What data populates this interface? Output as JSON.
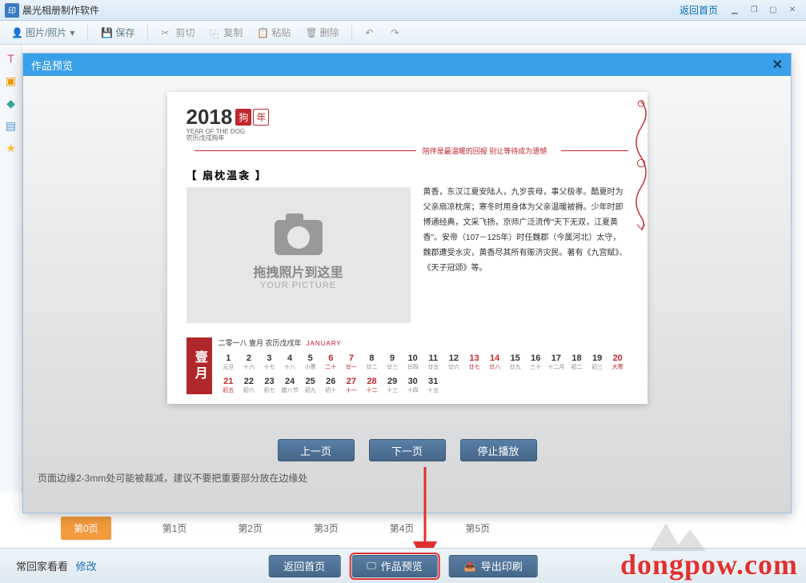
{
  "app": {
    "title": "晨光相册制作软件",
    "home_link": "返回首页"
  },
  "toolbar": {
    "photos": "图片/照片",
    "save": "保存",
    "cut": "剪切",
    "copy": "复制",
    "paste": "粘贴",
    "delete": "删除",
    "undo": "撤销",
    "redo": "重做"
  },
  "modal": {
    "title": "作品预览",
    "prev": "上一页",
    "next": "下一页",
    "stop": "停止播放",
    "hint": "页面边缘2-3mm处可能被裁减，建议不要把重要部分放在边缘处"
  },
  "card": {
    "year": "2018",
    "zodiac_in": "狗",
    "zodiac_out": "年",
    "year_sub_en": "YEAR OF THE DOG",
    "year_sub_cn": "农历戊戌狗年",
    "slogan": "陪伴是最温暖的回报  别让等待成为遗憾",
    "photo_title": "【 扇枕温衾 】",
    "photo_l1": "拖拽照片到这里",
    "photo_l2": "YOUR PICTURE",
    "story": "黄香，东汉江夏安陆人，九岁丧母，事父极孝。酷夏时为父亲扇凉枕席；寒冬时用身体为父亲温暖被褥。少年时即博通经典，文采飞扬，京师广泛流传\"天下无双，江夏黄香\"。安帝（107－125年）时任魏郡（今属河北）太守，魏郡遭受水灾，黄香尽其所有赈济灾民。著有《九宫赋》、《天子冠颂》等。"
  },
  "calendar": {
    "header_cn": "二零一八 壹月 农历戊戌年",
    "header_en": "JANUARY",
    "month_label": "壹月",
    "row1": [
      {
        "n": "1",
        "s": "元旦",
        "w": false
      },
      {
        "n": "2",
        "s": "十六",
        "w": false
      },
      {
        "n": "3",
        "s": "十七",
        "w": false
      },
      {
        "n": "4",
        "s": "十八",
        "w": false
      },
      {
        "n": "5",
        "s": "小寒",
        "w": false
      },
      {
        "n": "6",
        "s": "二十",
        "w": true
      },
      {
        "n": "7",
        "s": "廿一",
        "w": true
      },
      {
        "n": "8",
        "s": "廿二",
        "w": false
      },
      {
        "n": "9",
        "s": "廿三",
        "w": false
      },
      {
        "n": "10",
        "s": "廿四",
        "w": false
      },
      {
        "n": "11",
        "s": "廿五",
        "w": false
      },
      {
        "n": "12",
        "s": "廿六",
        "w": false
      },
      {
        "n": "13",
        "s": "廿七",
        "w": true
      },
      {
        "n": "14",
        "s": "廿八",
        "w": true
      },
      {
        "n": "15",
        "s": "廿九",
        "w": false
      },
      {
        "n": "16",
        "s": "三十",
        "w": false
      },
      {
        "n": "17",
        "s": "十二月",
        "w": false
      },
      {
        "n": "18",
        "s": "初二",
        "w": false
      },
      {
        "n": "19",
        "s": "初三",
        "w": false
      },
      {
        "n": "20",
        "s": "大寒",
        "w": true
      }
    ],
    "row2": [
      {
        "n": "21",
        "s": "初五",
        "w": true
      },
      {
        "n": "22",
        "s": "初六",
        "w": false
      },
      {
        "n": "23",
        "s": "初七",
        "w": false
      },
      {
        "n": "24",
        "s": "腊八节",
        "w": false
      },
      {
        "n": "25",
        "s": "初九",
        "w": false
      },
      {
        "n": "26",
        "s": "初十",
        "w": false
      },
      {
        "n": "27",
        "s": "十一",
        "w": true
      },
      {
        "n": "28",
        "s": "十二",
        "w": true
      },
      {
        "n": "29",
        "s": "十三",
        "w": false
      },
      {
        "n": "30",
        "s": "十四",
        "w": false
      },
      {
        "n": "31",
        "s": "十五",
        "w": false
      },
      {
        "n": "",
        "s": "",
        "w": false
      },
      {
        "n": "",
        "s": "",
        "w": false
      },
      {
        "n": "",
        "s": "",
        "w": false
      },
      {
        "n": "",
        "s": "",
        "w": false
      },
      {
        "n": "",
        "s": "",
        "w": false
      },
      {
        "n": "",
        "s": "",
        "w": false
      },
      {
        "n": "",
        "s": "",
        "w": false
      },
      {
        "n": "",
        "s": "",
        "w": false
      },
      {
        "n": "",
        "s": "",
        "w": false
      }
    ]
  },
  "pages": [
    "第0页",
    "第1页",
    "第2页",
    "第3页",
    "第4页",
    "第5页"
  ],
  "bottom": {
    "go_home": "常回家看看",
    "edit": "修改",
    "b1": "返回首页",
    "b2": "作品预览",
    "b3": "导出印刷"
  },
  "watermark": "dongpow.com"
}
